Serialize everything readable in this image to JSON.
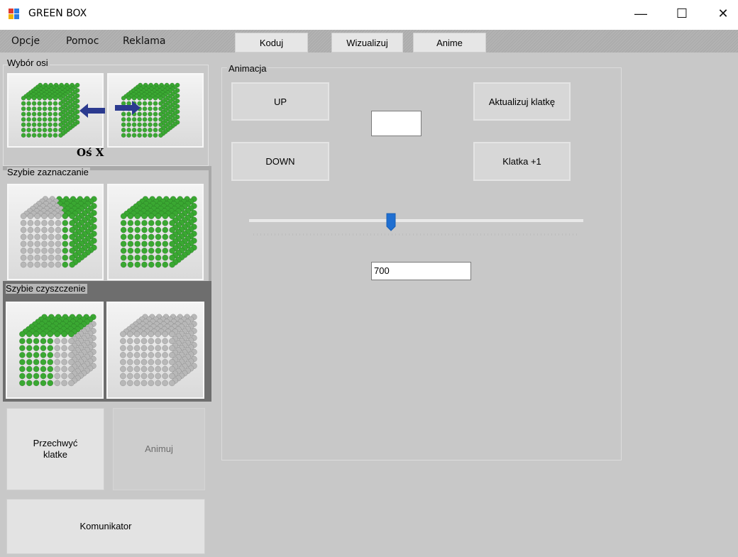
{
  "window": {
    "title": "GREEN BOX",
    "minimize": "—",
    "maximize": "☐",
    "close": "✕"
  },
  "menu": {
    "items": [
      "Opcje",
      "Pomoc",
      "Reklama"
    ]
  },
  "toolbar": {
    "koduj": "Koduj",
    "wizualizuj": "Wizualizuj",
    "anime": "Anime"
  },
  "left": {
    "axis_group": {
      "label": "Wybór osi",
      "caption": "Oś X"
    },
    "quick_select": {
      "label": "Szybie zaznaczanie"
    },
    "quick_clear": {
      "label": "Szybie czyszczenie"
    },
    "capture_frame": "Przechwyć klatke",
    "animate": "Animuj",
    "communicator": "Komunikator"
  },
  "animation": {
    "label": "Animacja",
    "up": "UP",
    "down": "DOWN",
    "update_frame": "Aktualizuj klatkę",
    "frame_plus": "Klatka +1",
    "frame_value": "",
    "delay_value": "700",
    "slider_level": 0.42
  },
  "colors": {
    "green": "#3aa832",
    "grey": "#b8b8b8",
    "accent_blue": "#1f6fd1"
  }
}
